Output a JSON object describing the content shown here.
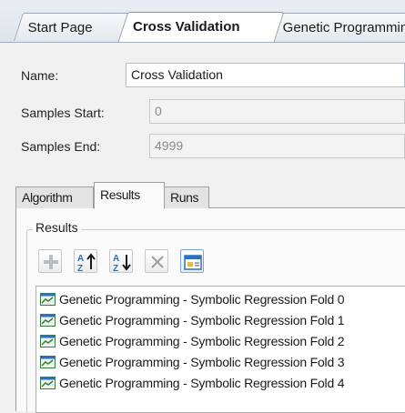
{
  "document_tabs": [
    {
      "label": "Start Page",
      "active": false
    },
    {
      "label": "Cross Validation",
      "active": true
    },
    {
      "label": "Genetic Programming",
      "active": false
    }
  ],
  "form": {
    "name_label": "Name:",
    "name_value": "Cross Validation",
    "samples_start_label": "Samples Start:",
    "samples_start_value": "0",
    "samples_end_label": "Samples End:",
    "samples_end_value": "4999"
  },
  "inner_tabs": [
    {
      "label": "Algorithm",
      "active": false
    },
    {
      "label": "Results",
      "active": true
    },
    {
      "label": "Runs",
      "active": false
    }
  ],
  "results": {
    "group_title": "Results",
    "toolbar": [
      "add-icon",
      "sort-ascending-icon",
      "sort-descending-icon",
      "remove-icon",
      "view-details-icon"
    ],
    "items": [
      "Genetic Programming - Symbolic Regression Fold 0",
      "Genetic Programming - Symbolic Regression Fold 1",
      "Genetic Programming - Symbolic Regression Fold 2",
      "Genetic Programming - Symbolic Regression Fold 3",
      "Genetic Programming - Symbolic Regression Fold 4"
    ]
  },
  "colors": {
    "accent": "#2f6fbf",
    "item_icon": "#3c7a3c"
  }
}
